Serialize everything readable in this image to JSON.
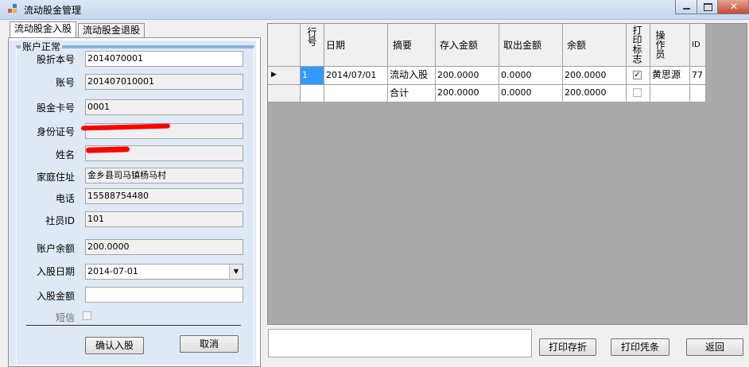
{
  "window": {
    "title": "流动股金管理"
  },
  "tabs": [
    {
      "label": "流动股金入股"
    },
    {
      "label": "流动股金退股"
    }
  ],
  "form": {
    "group_title": "账户正常",
    "fields": {
      "book_no": {
        "label": "股折本号",
        "value": "2014070001"
      },
      "account_no": {
        "label": "账号",
        "value": "201407010001"
      },
      "card_no": {
        "label": "股金卡号",
        "value": "0001"
      },
      "id_no": {
        "label": "身份证号"
      },
      "name": {
        "label": "姓名"
      },
      "address": {
        "label": "家庭住址",
        "value": "金乡县司马镇杨马村"
      },
      "phone": {
        "label": "电话",
        "value": "15588754480"
      },
      "member_id": {
        "label": "社员ID",
        "value": "101"
      },
      "balance": {
        "label": "账户余额",
        "value": "200.0000"
      },
      "join_date": {
        "label": "入股日期",
        "value": "2014-07-01"
      },
      "amount": {
        "label": "入股金额",
        "value": ""
      },
      "sms": {
        "label": "短信"
      }
    },
    "buttons": {
      "confirm": "确认入股",
      "cancel": "取消"
    }
  },
  "grid": {
    "columns": {
      "row_no": "行号",
      "date": "日期",
      "summary": "摘要",
      "deposit": "存入金额",
      "withdraw": "取出金额",
      "balance": "余额",
      "print_flag": "打印标志",
      "operator": "操作员",
      "id": "ID"
    },
    "rows": [
      {
        "row_no": "1",
        "date": "2014/07/01",
        "summary": "流动入股",
        "deposit": "200.0000",
        "withdraw": "0.0000",
        "balance": "200.0000",
        "print_flag": "✓",
        "operator": "黄思源",
        "id": "77"
      },
      {
        "row_no": "",
        "date": "",
        "summary": "合计",
        "deposit": "200.0000",
        "withdraw": "0.0000",
        "balance": "200.0000",
        "print_flag": "",
        "operator": "",
        "id": ""
      }
    ],
    "row_indicator": "▶"
  },
  "bottom_buttons": {
    "print_book": "打印存折",
    "print_voucher": "打印凭条",
    "back": "返回"
  },
  "icons": {
    "dropdown": "chevron-down-icon"
  }
}
